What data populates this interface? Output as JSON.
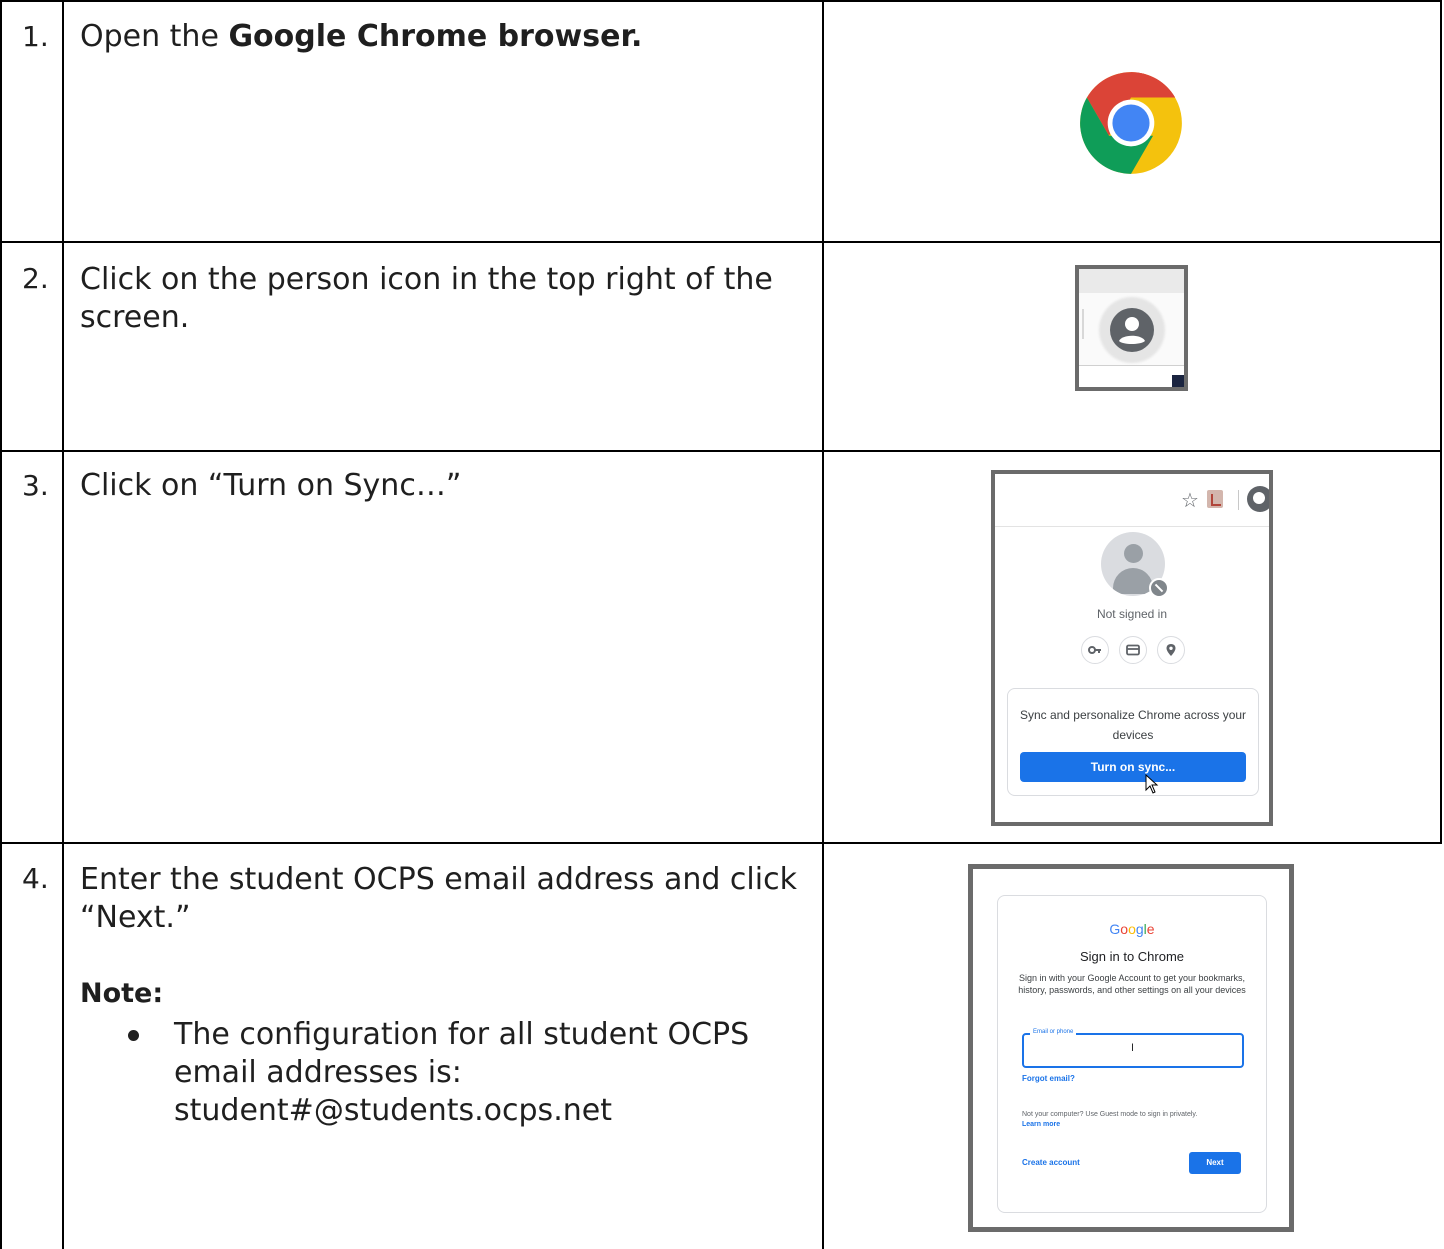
{
  "steps": [
    {
      "number": "1.",
      "text_before": "Open the ",
      "text_bold": "Google Chrome browser.",
      "image_icon": "chrome-logo-icon"
    },
    {
      "number": "2.",
      "text": "Click on the person icon in the top right of the screen.",
      "image_icon": "person-icon"
    },
    {
      "number": "3.",
      "text": "Click on “Turn on Sync…”",
      "screenshot": {
        "not_signed_in": "Not signed in",
        "sync_message": "Sync and personalize Chrome across your devices",
        "button": "Turn on sync..."
      }
    },
    {
      "number": "4.",
      "text": "Enter the student OCPS email address and click “Next.”",
      "note_title": "Note:",
      "note_bullet": "The configuration for all student OCPS email addresses is: student#@students.ocps.net",
      "screenshot": {
        "brand": "Google",
        "title": "Sign in to Chrome",
        "description": "Sign in with your Google Account to get your bookmarks, history, passwords, and other settings on all your devices",
        "field_label": "Email or phone",
        "forgot": "Forgot email?",
        "guest_text": "Not your computer? Use Guest mode to sign in privately.",
        "learn_more": "Learn more",
        "create_account": "Create account",
        "next": "Next"
      }
    }
  ],
  "colors": {
    "google_blue": "#1a73e8",
    "chrome_red": "#db4437",
    "chrome_yellow": "#f4c20d",
    "chrome_green": "#0f9d58"
  }
}
